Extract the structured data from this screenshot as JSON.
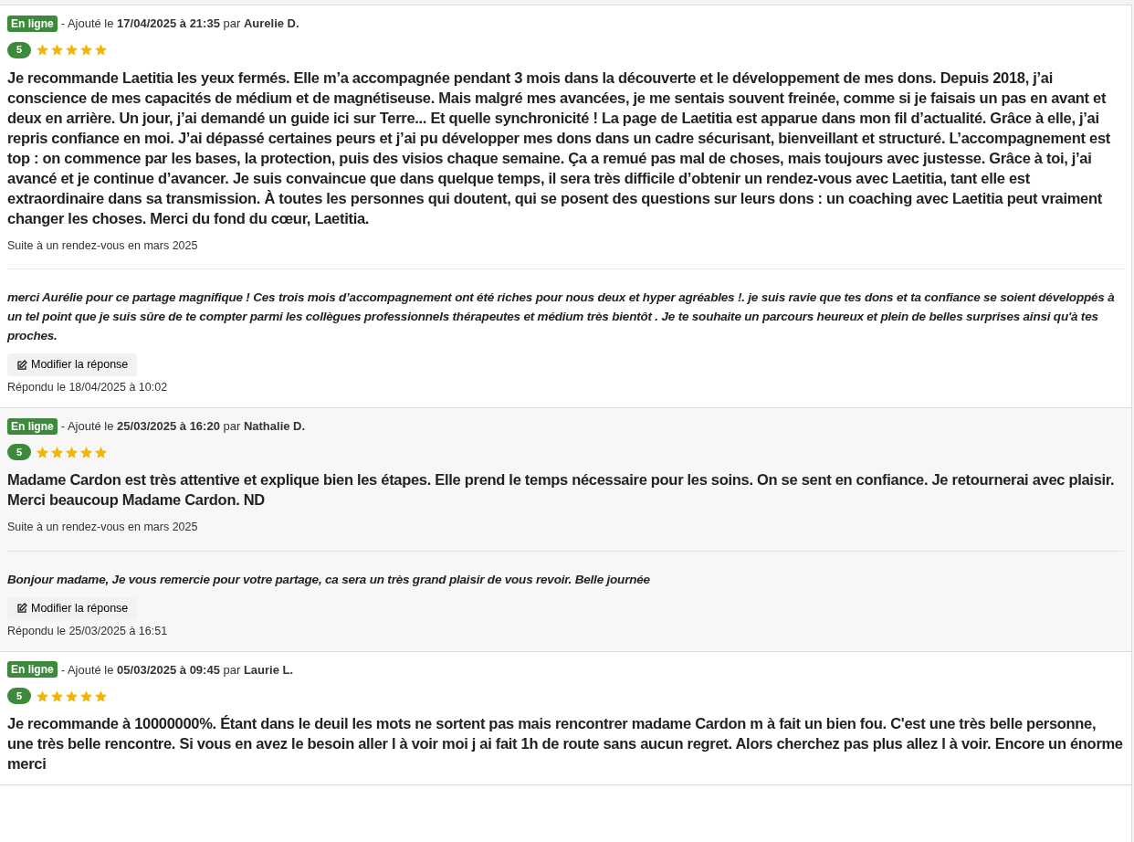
{
  "reviews": [
    {
      "status": "En ligne",
      "meta": "- Ajouté le **17/04/2025 à 21:35** par **Aurelie D.**",
      "score": "5",
      "stars": 5,
      "text": "Je recommande Laetitia les yeux fermés. Elle m’a accompagnée pendant 3 mois dans la découverte et le développement de mes dons.  Depuis 2018, j’ai conscience de mes capacités de médium et de magnétiseuse. Mais malgré mes avancées, je me sentais souvent freinée, comme si je faisais un pas en avant et deux en arrière. Un jour, j’ai demandé un guide ici sur Terre... Et quelle synchronicité ! La page de Laetitia est apparue dans mon fil d’actualité.  Grâce à elle, j’ai repris confiance en moi. J’ai dépassé certaines peurs et j’ai pu développer mes dons dans un cadre sécurisant, bienveillant et structuré. L’accompagnement est top : on commence par les bases, la protection, puis des visios chaque semaine. Ça a remué pas mal de choses, mais toujours avec justesse. Grâce à toi, j’ai avancé et je continue d’avancer.  Je suis convaincue que dans quelque temps, il sera très difficile d’obtenir un rendez-vous avec Laetitia, tant elle est extraordinaire dans sa transmission. À toutes les personnes qui doutent, qui se posent des questions sur leurs dons : un coaching avec Laetitia peut vraiment changer les choses. Merci du fond du cœur, Laetitia.",
      "context": "Suite à un rendez-vous en mars 2025",
      "reply": {
        "text": "merci Aurélie pour ce partage magnifique ! Ces trois mois d’accompagnement ont été riches pour nous deux et hyper agréables !. je suis ravie que tes dons et ta confiance se soient développés à un tel point que je suis sûre de te compter parmi les collègues professionnels thérapeutes et médium très bientôt . Je te souhaite un parcours heureux et plein de belles surprises ainsi qu'à tes proches.",
        "button": "Modifier la réponse",
        "date": "Répondu le 18/04/2025 à 10:02"
      }
    },
    {
      "status": "En ligne",
      "meta": "- Ajouté le **25/03/2025 à 16:20** par **Nathalie D.**",
      "score": "5",
      "stars": 5,
      "text": "Madame Cardon est très attentive et explique bien les étapes. Elle prend le temps nécessaire pour les soins. On se sent en confiance. Je retournerai avec plaisir. Merci beaucoup Madame Cardon. ND",
      "context": "Suite à un rendez-vous en mars 2025",
      "reply": {
        "text": "Bonjour madame, Je vous remercie pour votre partage, ca sera un très grand plaisir de vous revoir. Belle journée",
        "button": "Modifier la réponse",
        "date": "Répondu le 25/03/2025 à 16:51"
      }
    },
    {
      "status": "En ligne",
      "meta": "- Ajouté le **05/03/2025 à 09:45** par **Laurie L.**",
      "score": "5",
      "stars": 5,
      "text": "Je recommande à 10000000%. Étant dans le deuil les mots ne sortent pas mais rencontrer madame Cardon m à fait un bien fou. C'est une très belle personne, une très belle rencontre. Si vous en avez le besoin aller l à voir moi j ai fait 1h de route sans aucun regret. Alors cherchez pas plus allez l à voir. Encore un énorme merci"
    }
  ]
}
